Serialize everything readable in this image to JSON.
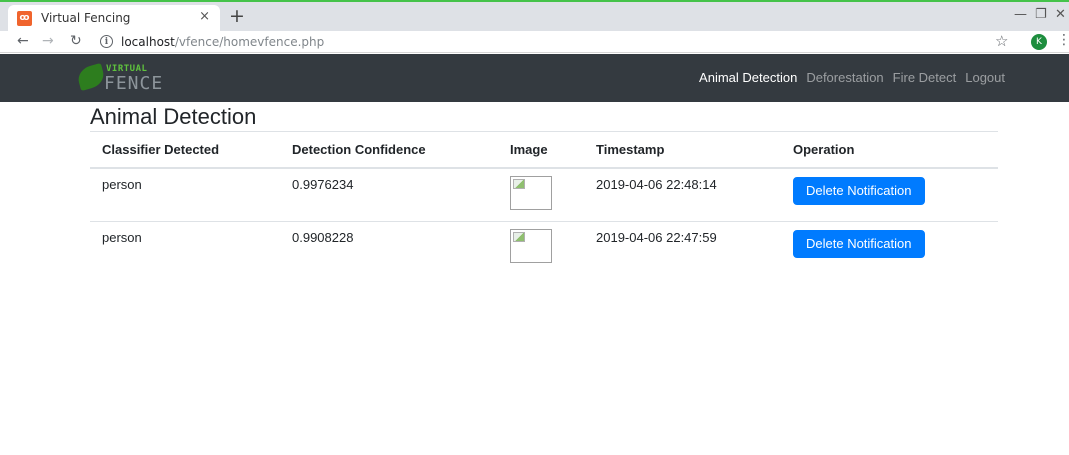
{
  "browser": {
    "tab_title": "Virtual Fencing",
    "tab_close": "×",
    "new_tab": "+",
    "url_host": "localhost",
    "url_path": "/vfence/homevfence.php",
    "profile_initial": "K"
  },
  "site": {
    "brand_top": "VIRTUAL",
    "brand_bottom": "FENCE",
    "nav": [
      {
        "label": "Animal Detection",
        "active": true
      },
      {
        "label": "Deforestation",
        "active": false
      },
      {
        "label": "Fire Detect",
        "active": false
      },
      {
        "label": "Logout",
        "active": false
      }
    ]
  },
  "main": {
    "title": "Animal Detection",
    "columns": [
      "Classifier Detected",
      "Detection Confidence",
      "Image",
      "Timestamp",
      "Operation"
    ],
    "rows": [
      {
        "classifier": "person",
        "confidence": "0.9976234",
        "timestamp": "2019-04-06 22:48:14",
        "action": "Delete Notification"
      },
      {
        "classifier": "person",
        "confidence": "0.9908228",
        "timestamp": "2019-04-06 22:47:59",
        "action": "Delete Notification"
      }
    ]
  },
  "colors": {
    "navbar_bg": "#343a40",
    "button_primary": "#007bff",
    "tab_accent": "#45c34a"
  }
}
